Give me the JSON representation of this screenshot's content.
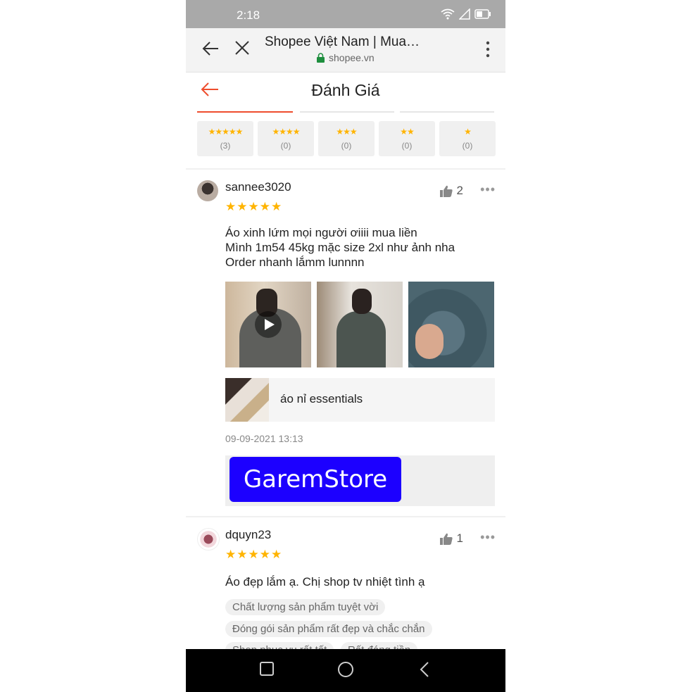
{
  "status": {
    "time": "2:18"
  },
  "browser": {
    "title": "Shopee Việt Nam | Mua…",
    "url": "shopee.vn"
  },
  "header": {
    "title": "Đánh Giá"
  },
  "filters": [
    {
      "stars": "★★★★★",
      "count": "(3)"
    },
    {
      "stars": "★★★★",
      "count": "(0)"
    },
    {
      "stars": "★★★",
      "count": "(0)"
    },
    {
      "stars": "★★",
      "count": "(0)"
    },
    {
      "stars": "★",
      "count": "(0)"
    }
  ],
  "reviews": [
    {
      "username": "sannee3020",
      "stars": "★★★★★",
      "likes": "2",
      "text": "Áo xinh lứm mọi người ơiiii mua liền\nMình 1m54 45kg mặc size 2xl như ảnh nha\nOrder nhanh lắmm lunnnn",
      "product": "áo nỉ essentials",
      "date": "09-09-2021 13:13",
      "seller_badge": "GaremStore"
    },
    {
      "username": "dquyn23",
      "stars": "★★★★★",
      "likes": "1",
      "text": "Áo đẹp lắm ạ. Chị shop tv nhiệt tình ạ",
      "tags": [
        "Chất lượng sản phẩm tuyệt vời",
        "Đóng gói sản phẩm rất đẹp và chắc chắn",
        "Shop phục vụ rất tốt",
        "Rất đáng tiền"
      ]
    }
  ],
  "colors": {
    "accent": "#ee4d2d",
    "star": "#ffb400",
    "store": "#1c00ff"
  }
}
